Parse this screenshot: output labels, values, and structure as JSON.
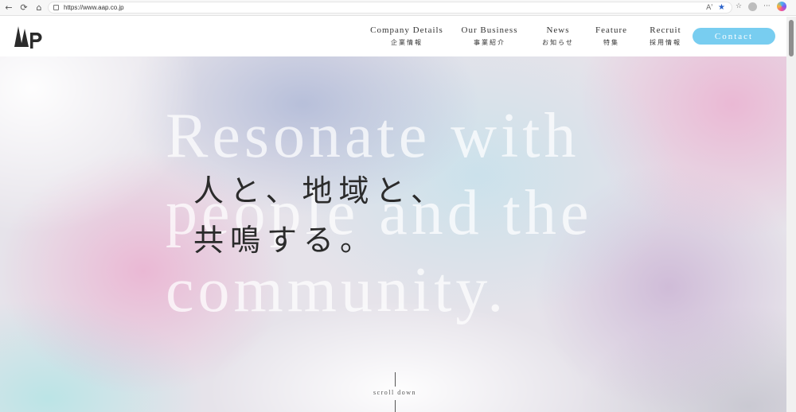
{
  "browser": {
    "back": "←",
    "reload": "⟳",
    "home": "⌂",
    "url": "https://www.aap.co.jp",
    "read_aloud": "Aʾ",
    "favorite": "★",
    "collections": "☆",
    "more": "···"
  },
  "nav": {
    "items": [
      {
        "en": "Company Details",
        "ja": "企業情報"
      },
      {
        "en": "Our Business",
        "ja": "事業紹介"
      },
      {
        "en": "News",
        "ja": "お知らせ"
      },
      {
        "en": "Feature",
        "ja": "特集"
      },
      {
        "en": "Recruit",
        "ja": "採用情報"
      }
    ],
    "contact": "Contact"
  },
  "hero": {
    "en_lines": [
      "Resonate with",
      "people and the",
      "community."
    ],
    "ja_lines": [
      "人と、地域と、",
      "共鳴する。"
    ],
    "scroll_label": "scroll down"
  },
  "colors": {
    "accent": "#78cdf0",
    "text": "#2b2b2b"
  },
  "icons": [
    "back-arrow-icon",
    "reload-icon",
    "home-icon",
    "lock-icon",
    "star-icon",
    "avatar-icon",
    "copilot-icon",
    "logo"
  ]
}
